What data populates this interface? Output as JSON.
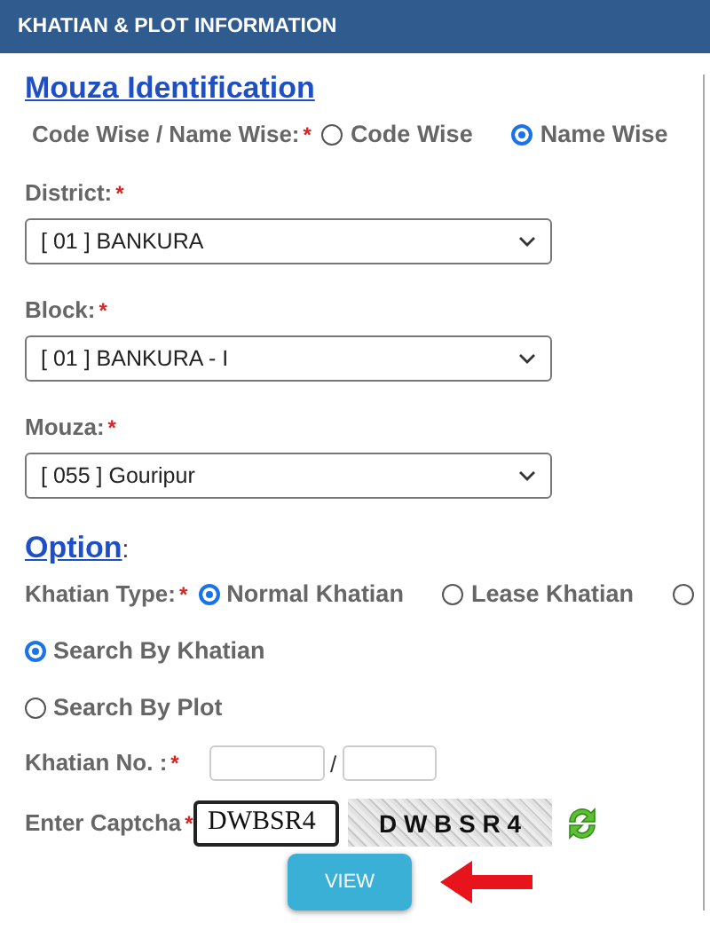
{
  "header": {
    "title": "KHATIAN & PLOT INFORMATION"
  },
  "mouza_section": {
    "title": "Mouza Identification",
    "mode_label": "Code Wise / Name Wise:",
    "required_mark": "*",
    "modes": [
      {
        "label": "Code Wise",
        "selected": false
      },
      {
        "label": "Name Wise",
        "selected": true
      }
    ],
    "selects": [
      {
        "label": "District:",
        "required_mark": "*",
        "value": "[ 01 ] BANKURA"
      },
      {
        "label": "Block:",
        "required_mark": "*",
        "value": "[ 01 ] BANKURA - I"
      },
      {
        "label": "Mouza:",
        "required_mark": "*",
        "value": "[ 055 ] Gouripur"
      }
    ]
  },
  "option_section": {
    "title": "Option",
    "colon": ":",
    "type_label": "Khatian Type:",
    "required_mark": "*",
    "types": [
      {
        "label": "Normal Khatian",
        "selected": true
      },
      {
        "label": "Lease Khatian",
        "selected": false
      },
      {
        "selected": false
      }
    ],
    "search_modes": [
      {
        "label": "Search By Khatian",
        "selected": true
      },
      {
        "label": "Search By Plot",
        "selected": false
      }
    ],
    "khatian_no": {
      "label": "Khatian No. :",
      "required_mark": "*",
      "separator": "/"
    },
    "captcha": {
      "label": "Enter Captcha",
      "required_mark": "*",
      "value": "DWBSR4",
      "image_text": "D W B S R 4"
    },
    "view_button": "VIEW"
  }
}
